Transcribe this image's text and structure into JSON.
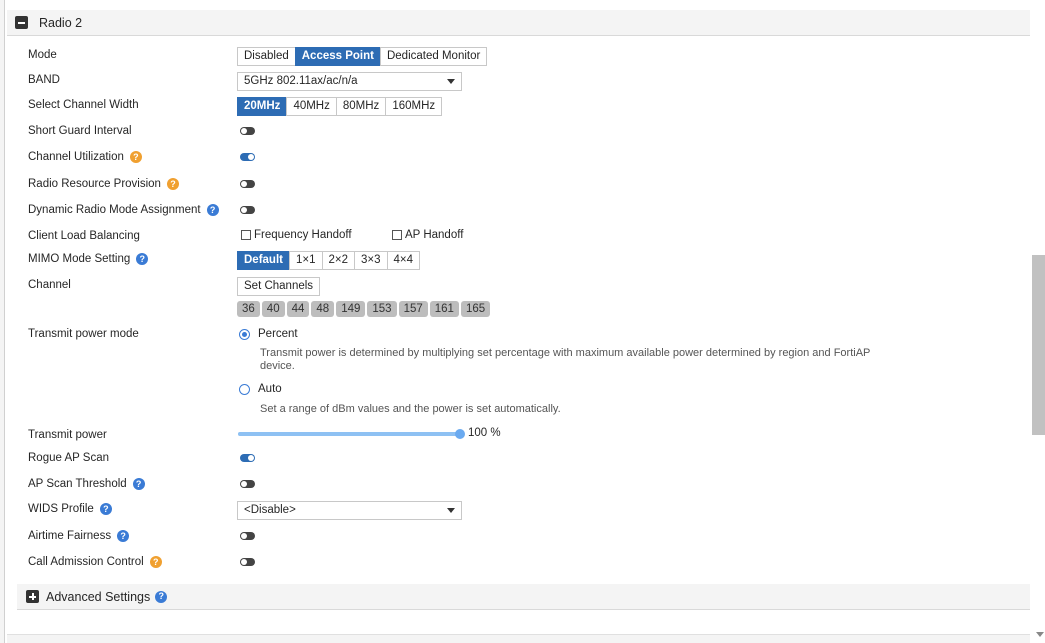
{
  "radio_section": {
    "title": "Radio 2"
  },
  "fields": {
    "mode": {
      "label": "Mode",
      "options": [
        "Disabled",
        "Access Point",
        "Dedicated Monitor"
      ],
      "selected": "Access Point"
    },
    "band": {
      "label": "BAND",
      "value": "5GHz 802.11ax/ac/n/a"
    },
    "channel_width": {
      "label": "Select Channel Width",
      "options": [
        "20MHz",
        "40MHz",
        "80MHz",
        "160MHz"
      ],
      "selected": "20MHz"
    },
    "short_guard": {
      "label": "Short Guard Interval",
      "enabled": false
    },
    "channel_util": {
      "label": "Channel Utilization",
      "enabled": true,
      "help_color": "#f0a030"
    },
    "rrp": {
      "label": "Radio Resource Provision",
      "enabled": false,
      "help_color": "#f0a030"
    },
    "drma": {
      "label": "Dynamic Radio Mode Assignment",
      "enabled": false,
      "help_color": "#3a7bd5"
    },
    "clb": {
      "label": "Client Load Balancing",
      "freq_handoff": "Frequency Handoff",
      "ap_handoff": "AP Handoff",
      "freq_checked": false,
      "ap_checked": false
    },
    "mimo": {
      "label": "MIMO Mode Setting",
      "options": [
        "Default",
        "1×1",
        "2×2",
        "3×3",
        "4×4"
      ],
      "selected": "Default"
    },
    "channel": {
      "label": "Channel",
      "button": "Set Channels",
      "channels": [
        "36",
        "40",
        "44",
        "48",
        "149",
        "153",
        "157",
        "161",
        "165"
      ]
    },
    "tx_mode": {
      "label": "Transmit power mode",
      "percent_label": "Percent",
      "percent_desc": "Transmit power is determined by multiplying set percentage with maximum available power determined by region and FortiAP device.",
      "auto_label": "Auto",
      "auto_desc": "Set a range of dBm values and the power is set automatically.",
      "selected": "Percent"
    },
    "tx_power": {
      "label": "Transmit power",
      "value": 100,
      "value_text": "100 %"
    },
    "rogue_scan": {
      "label": "Rogue AP Scan",
      "enabled": true
    },
    "ap_scan_threshold": {
      "label": "AP Scan Threshold",
      "enabled": false,
      "help_color": "#3a7bd5"
    },
    "wids": {
      "label": "WIDS Profile",
      "value": "<Disable>",
      "help_color": "#3a7bd5"
    },
    "airtime": {
      "label": "Airtime Fairness",
      "enabled": false,
      "help_color": "#3a7bd5"
    },
    "cac": {
      "label": "Call Admission Control",
      "enabled": false,
      "help_color": "#f0a030"
    }
  },
  "advanced": {
    "title": "Advanced Settings"
  },
  "icons": {
    "collapse": "minus-square-icon",
    "expand": "plus-square-icon",
    "help": "question-circle-icon",
    "dropdown": "caret-down-icon"
  }
}
